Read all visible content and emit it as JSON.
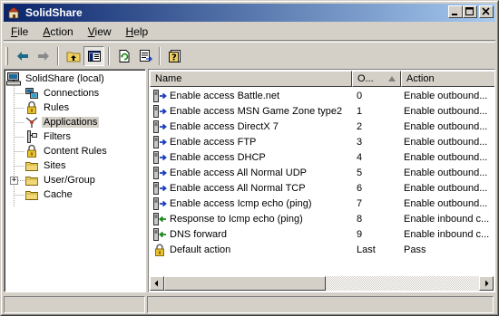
{
  "window": {
    "title": "SolidShare",
    "minimize": "_",
    "maximize": "□",
    "close": "×"
  },
  "menu": [
    {
      "label": "File",
      "accel": "F",
      "rest": "ile"
    },
    {
      "label": "Action",
      "accel": "A",
      "rest": "ction"
    },
    {
      "label": "View",
      "accel": "V",
      "rest": "iew"
    },
    {
      "label": "Help",
      "accel": "H",
      "rest": "elp"
    }
  ],
  "toolbar": {
    "icons": [
      "back-arrow-icon",
      "forward-arrow-icon",
      "up-folder-icon",
      "show-tree-icon",
      "refresh-icon",
      "export-list-icon",
      "help-icon"
    ]
  },
  "tree": {
    "root": "SolidShare (local)",
    "items": [
      {
        "label": "Connections",
        "icon": "connections-icon"
      },
      {
        "label": "Rules",
        "icon": "lock-icon"
      },
      {
        "label": "Applications",
        "icon": "applications-icon",
        "selected": true
      },
      {
        "label": "Filters",
        "icon": "filter-icon"
      },
      {
        "label": "Content Rules",
        "icon": "lock-icon"
      },
      {
        "label": "Sites",
        "icon": "folder-icon"
      },
      {
        "label": "User/Group",
        "icon": "folder-icon",
        "expander": "+"
      },
      {
        "label": "Cache",
        "icon": "folder-icon"
      }
    ]
  },
  "list": {
    "columns": {
      "name": "Name",
      "order": "O...",
      "action": "Action"
    },
    "rows": [
      {
        "name": "Enable access Battle.net",
        "order": "0",
        "action": "Enable outbound...",
        "icon": "outbound"
      },
      {
        "name": "Enable access MSN Game Zone type2",
        "order": "1",
        "action": "Enable outbound...",
        "icon": "outbound"
      },
      {
        "name": "Enable access DirectX 7",
        "order": "2",
        "action": "Enable outbound...",
        "icon": "outbound"
      },
      {
        "name": "Enable access FTP",
        "order": "3",
        "action": "Enable outbound...",
        "icon": "outbound"
      },
      {
        "name": "Enable access DHCP",
        "order": "4",
        "action": "Enable outbound...",
        "icon": "outbound"
      },
      {
        "name": "Enable access All Normal UDP",
        "order": "5",
        "action": "Enable outbound...",
        "icon": "outbound"
      },
      {
        "name": "Enable access All Normal TCP",
        "order": "6",
        "action": "Enable outbound...",
        "icon": "outbound"
      },
      {
        "name": "Enable access Icmp echo (ping)",
        "order": "7",
        "action": "Enable outbound...",
        "icon": "outbound"
      },
      {
        "name": "Response to Icmp echo (ping)",
        "order": "8",
        "action": "Enable inbound c...",
        "icon": "inbound"
      },
      {
        "name": "DNS forward",
        "order": "9",
        "action": "Enable inbound c...",
        "icon": "inbound"
      },
      {
        "name": "Default action",
        "order": "Last",
        "action": "Pass",
        "icon": "lock"
      }
    ]
  },
  "colors": {
    "titlebar_start": "#0a246a",
    "titlebar_end": "#a6caf0",
    "face": "#d4d0c8",
    "outbound_arrow": "#1f3fbf",
    "inbound_arrow": "#1a8a1a"
  }
}
